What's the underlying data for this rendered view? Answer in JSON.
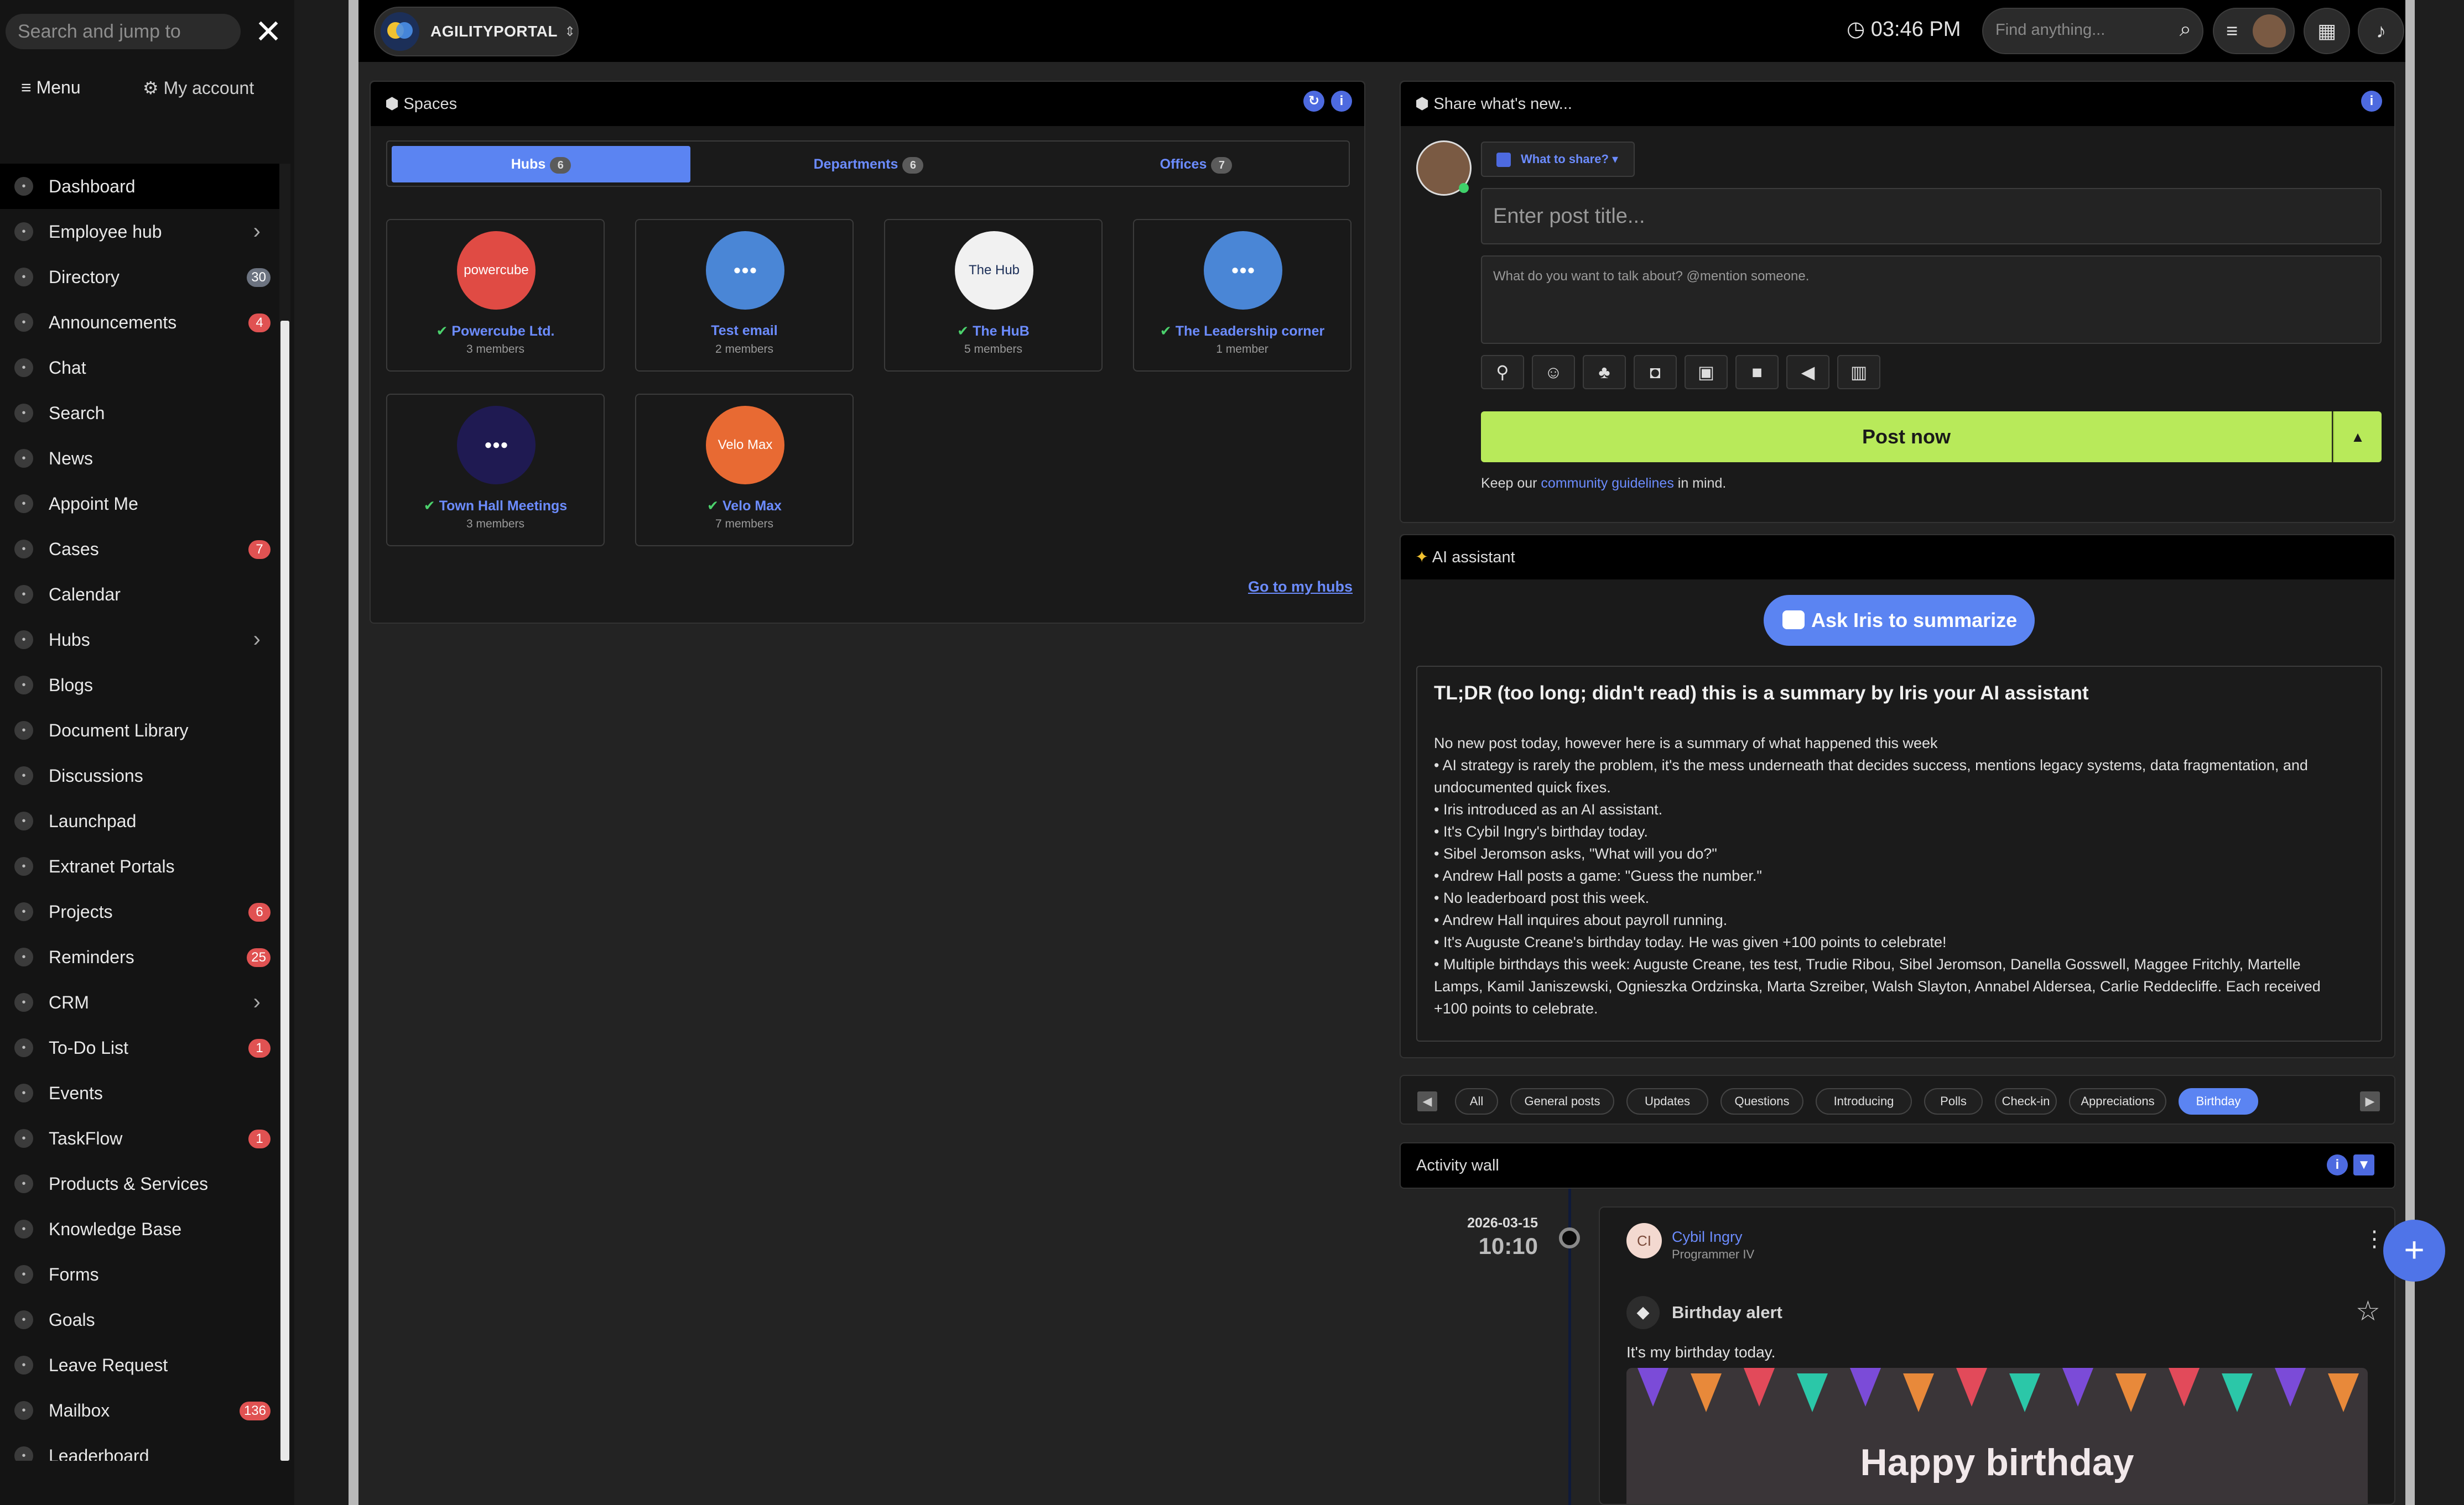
{
  "sidebar": {
    "search_placeholder": "Search and jump to",
    "menu_label": "Menu",
    "account_label": "My account",
    "items": [
      {
        "label": "Dashboard",
        "icon": "dashboard-icon",
        "active": true
      },
      {
        "label": "Employee hub",
        "icon": "people-icon",
        "chevron": true
      },
      {
        "label": "Directory",
        "icon": "directory-icon",
        "badge": "30",
        "badge_style": "grey"
      },
      {
        "label": "Announcements",
        "icon": "megaphone-icon",
        "badge": "4"
      },
      {
        "label": "Chat",
        "icon": "chat-icon"
      },
      {
        "label": "Search",
        "icon": "search-icon"
      },
      {
        "label": "News",
        "icon": "news-icon"
      },
      {
        "label": "Appoint Me",
        "icon": "appointment-icon"
      },
      {
        "label": "Cases",
        "icon": "cases-icon",
        "badge": "7"
      },
      {
        "label": "Calendar",
        "icon": "calendar-icon"
      },
      {
        "label": "Hubs",
        "icon": "hubs-icon",
        "chevron": true
      },
      {
        "label": "Blogs",
        "icon": "blogs-icon"
      },
      {
        "label": "Document Library",
        "icon": "document-icon"
      },
      {
        "label": "Discussions",
        "icon": "discussion-icon"
      },
      {
        "label": "Launchpad",
        "icon": "rocket-icon"
      },
      {
        "label": "Extranet Portals",
        "icon": "portal-icon"
      },
      {
        "label": "Projects",
        "icon": "projects-icon",
        "badge": "6"
      },
      {
        "label": "Reminders",
        "icon": "reminder-icon",
        "badge": "25"
      },
      {
        "label": "CRM",
        "icon": "crm-icon",
        "chevron": true
      },
      {
        "label": "To-Do List",
        "icon": "todo-icon",
        "badge": "1"
      },
      {
        "label": "Events",
        "icon": "events-icon"
      },
      {
        "label": "TaskFlow",
        "icon": "taskflow-icon",
        "badge": "1"
      },
      {
        "label": "Products & Services",
        "icon": "products-icon"
      },
      {
        "label": "Knowledge Base",
        "icon": "knowledge-icon"
      },
      {
        "label": "Forms",
        "icon": "forms-icon"
      },
      {
        "label": "Goals",
        "icon": "goals-icon"
      },
      {
        "label": "Leave Request",
        "icon": "plane-icon"
      },
      {
        "label": "Mailbox",
        "icon": "mailbox-icon",
        "badge": "136"
      },
      {
        "label": "Leaderboard",
        "icon": "leaderboard-icon"
      }
    ]
  },
  "topbar": {
    "org_name": "AGILITYPORTAL",
    "time": "03:46 PM",
    "find_placeholder": "Find anything..."
  },
  "spaces": {
    "title": "Spaces",
    "tabs": [
      {
        "label": "Hubs",
        "count": "6",
        "selected": true
      },
      {
        "label": "Departments",
        "count": "6",
        "selected": false
      },
      {
        "label": "Offices",
        "count": "7",
        "selected": false
      }
    ],
    "hubs": [
      {
        "name": "Powercube Ltd.",
        "members": "3 members",
        "verified": true,
        "avatar_text": "powercube",
        "color": "#e04b44"
      },
      {
        "name": "Test email",
        "members": "2 members",
        "verified": false,
        "avatar_text": "",
        "color": "#4a86d6"
      },
      {
        "name": "The HuB",
        "members": "5 members",
        "verified": true,
        "avatar_text": "The Hub",
        "color": "#f1f1f1"
      },
      {
        "name": "The Leadership corner",
        "members": "1 member",
        "verified": true,
        "avatar_text": "",
        "color": "#4a86d6"
      },
      {
        "name": "Town Hall Meetings",
        "members": "3 members",
        "verified": true,
        "avatar_text": "",
        "color": "#1f1a52"
      },
      {
        "name": "Velo Max",
        "members": "7 members",
        "verified": true,
        "avatar_text": "Velo Max",
        "color": "#e86a33"
      }
    ],
    "go_link": "Go to my hubs"
  },
  "share": {
    "title": "Share what's new...",
    "what_to_share": "What to share?",
    "title_placeholder": "Enter post title...",
    "body_placeholder": "What do you want to talk about? @mention someone.",
    "post_button": "Post now",
    "guidelines_prefix": "Keep our ",
    "guidelines_link": "community guidelines",
    "guidelines_suffix": " in mind."
  },
  "ai": {
    "title": "AI assistant",
    "ask_button": "Ask Iris to summarize",
    "summary_title": "TL;DR (too long; didn't read) this is a summary by Iris your AI assistant",
    "summary_lines": [
      "No new post today, however here is a summary of what happened this week",
      "• AI strategy is rarely the problem, it's the mess underneath that decides success, mentions legacy systems, data fragmentation, and",
      "undocumented quick fixes.",
      "• Iris introduced as an AI assistant.",
      "• It's Cybil Ingry's birthday today.",
      "• Sibel Jeromson asks, \"What will you do?\"",
      "• Andrew Hall posts a game: \"Guess the number.\"",
      "• No leaderboard post this week.",
      "• Andrew Hall inquires about payroll running.",
      "• It's Auguste Creane's birthday today. He was given +100 points to celebrate!",
      "• Multiple birthdays this week: Auguste Creane, tes test, Trudie Ribou, Sibel Jeromson, Danella Gosswell, Maggee Fritchly, Martelle",
      "Lamps, Kamil Janiszewski, Ognieszka Ordzinska, Marta Szreiber, Walsh Slayton, Annabel Aldersea, Carlie Reddecliffe. Each received",
      "+100 points to celebrate."
    ]
  },
  "filters": [
    {
      "label": "All",
      "selected": false
    },
    {
      "label": "General posts",
      "selected": false
    },
    {
      "label": "Updates",
      "selected": false
    },
    {
      "label": "Questions",
      "selected": false
    },
    {
      "label": "Introducing",
      "selected": false
    },
    {
      "label": "Polls",
      "selected": false
    },
    {
      "label": "Check-in",
      "selected": false
    },
    {
      "label": "Appreciations",
      "selected": false
    },
    {
      "label": "Birthday",
      "selected": true
    }
  ],
  "activity": {
    "title": "Activity wall",
    "date": "2026-03-15",
    "time": "10:10",
    "post": {
      "initials": "CI",
      "author": "Cybil Ingry",
      "role": "Programmer IV",
      "type_title": "Birthday alert",
      "text": "It's my birthday today.",
      "image_text": "Happy birthday"
    }
  }
}
